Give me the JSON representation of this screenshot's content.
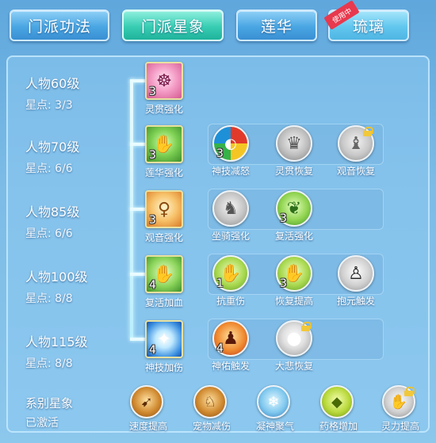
{
  "tabs": [
    {
      "label": "门派功法",
      "active": false
    },
    {
      "label": "门派星象",
      "active": true
    },
    {
      "label": "莲华",
      "active": false
    },
    {
      "label": "琉璃",
      "active": false,
      "badge": "使用中"
    }
  ],
  "tiers": [
    {
      "title": "人物60级",
      "stars": "星点: 3/3"
    },
    {
      "title": "人物70级",
      "stars": "星点: 6/6"
    },
    {
      "title": "人物85级",
      "stars": "星点: 6/6"
    },
    {
      "title": "人物100级",
      "stars": "星点: 8/8"
    },
    {
      "title": "人物115级",
      "stars": "星点: 8/8"
    }
  ],
  "skills": {
    "t60_main": {
      "label": "灵贯强化",
      "count": "3"
    },
    "t70_main": {
      "label": "莲华强化",
      "count": "3"
    },
    "t70_a": {
      "label": "神技减怒",
      "count": "3"
    },
    "t70_b": {
      "label": "灵贯恢复",
      "count": ""
    },
    "t70_c": {
      "label": "观音恢复",
      "count": ""
    },
    "t85_main": {
      "label": "观音强化",
      "count": "3"
    },
    "t85_a": {
      "label": "坐骑强化",
      "count": ""
    },
    "t85_b": {
      "label": "复活强化",
      "count": "3"
    },
    "t100_main": {
      "label": "复活加血",
      "count": "4"
    },
    "t100_a": {
      "label": "抗重伤",
      "count": "1"
    },
    "t100_b": {
      "label": "恢复提高",
      "count": "3"
    },
    "t100_c": {
      "label": "抱元触发",
      "count": ""
    },
    "t115_main": {
      "label": "神技加伤",
      "count": "4"
    },
    "t115_a": {
      "label": "神佑触发",
      "count": "4"
    },
    "t115_b": {
      "label": "大悲恢复",
      "count": ""
    }
  },
  "series": {
    "title": "系别星象",
    "status": "已激活",
    "items": [
      {
        "label": "速度提高"
      },
      {
        "label": "宠物减伤"
      },
      {
        "label": "凝神聚气"
      },
      {
        "label": "药格增加"
      },
      {
        "label": "灵力提高"
      }
    ]
  }
}
